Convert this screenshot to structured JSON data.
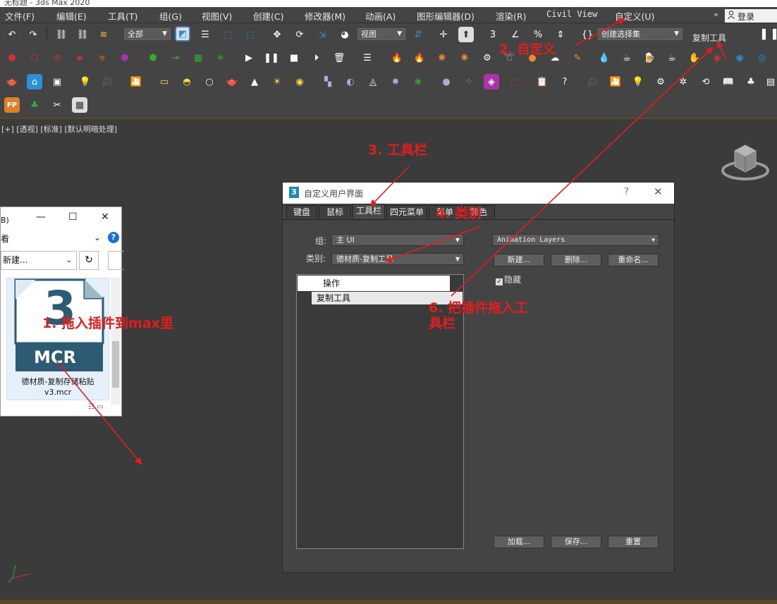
{
  "window": {
    "title": "无标题 - 3ds Max 2020"
  },
  "menubar": {
    "items": [
      "文件(F)",
      "编辑(E)",
      "工具(T)",
      "组(G)",
      "视图(V)",
      "创建(C)",
      "修改器(M)",
      "动画(A)",
      "图形编辑器(D)",
      "渲染(R)",
      "Civil View",
      "自定义(U)"
    ],
    "overflow": "»",
    "login": "登录"
  },
  "toolbar": {
    "selection_filter": "全部",
    "ref_coord": "视图",
    "named_selection": "创建选择集",
    "copy_tool_label": "复制工具",
    "accent_color": "#2d8fd6",
    "highlight_color": "#3c7cc4"
  },
  "viewport": {
    "label": "[+] [透视] [标准] [默认明暗处理]"
  },
  "explorer": {
    "title_fragment": "B)",
    "view_fragment": "看",
    "new_button": "新建...",
    "file_name_line1": "德材质-复制存储粘贴",
    "file_name_line2": "v3.mcr",
    "file_badge": "MCR",
    "file_logo_digit": "3"
  },
  "dialog": {
    "title": "自定义用户界面",
    "help": "?",
    "tabs": [
      "键盘",
      "鼠标",
      "工具栏",
      "四元菜单",
      "菜单",
      "颜色"
    ],
    "active_tab": "工具栏",
    "group_label": "组:",
    "group_value": "主 UI",
    "category_label": "类别:",
    "category_value": "德材质-复制工具",
    "list_header": "操作",
    "list_items": [
      "复制工具"
    ],
    "toolbar_select": "Animation Layers",
    "btn_new": "新建...",
    "btn_delete": "删除...",
    "btn_rename": "重命名...",
    "hide_checkbox": "隐藏",
    "hide_checked": true,
    "btn_load": "加载...",
    "btn_save": "保存...",
    "btn_reset": "重置"
  },
  "annotations": {
    "step1": "1. 拖入插件到max里",
    "step2": "2. 自定义",
    "step3": "3. 工具栏",
    "step4": "4. 类别",
    "step6_line1": "6. 把插件拖入工",
    "step6_line2": "具栏",
    "color": "#e01e1e"
  }
}
